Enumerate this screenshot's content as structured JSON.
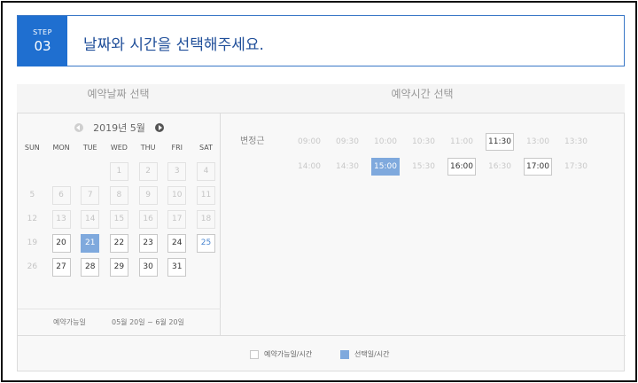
{
  "step": {
    "label": "STEP",
    "number": "03",
    "title": "날짜와 시간을 선택해주세요."
  },
  "calendar": {
    "header": "예약날짜 선택",
    "month_label": "2019년 5월",
    "weekdays": [
      "SUN",
      "MON",
      "TUE",
      "WED",
      "THU",
      "FRI",
      "SAT"
    ],
    "weeks": [
      [
        {
          "d": "",
          "s": "empty"
        },
        {
          "d": "",
          "s": "empty"
        },
        {
          "d": "",
          "s": "empty"
        },
        {
          "d": "1",
          "s": "disabled"
        },
        {
          "d": "2",
          "s": "disabled"
        },
        {
          "d": "3",
          "s": "disabled"
        },
        {
          "d": "4",
          "s": "disabled"
        }
      ],
      [
        {
          "d": "5",
          "s": "plain"
        },
        {
          "d": "6",
          "s": "disabled"
        },
        {
          "d": "7",
          "s": "disabled"
        },
        {
          "d": "8",
          "s": "disabled"
        },
        {
          "d": "9",
          "s": "disabled"
        },
        {
          "d": "10",
          "s": "disabled"
        },
        {
          "d": "11",
          "s": "disabled"
        }
      ],
      [
        {
          "d": "12",
          "s": "plain"
        },
        {
          "d": "13",
          "s": "disabled"
        },
        {
          "d": "14",
          "s": "disabled"
        },
        {
          "d": "15",
          "s": "disabled"
        },
        {
          "d": "16",
          "s": "disabled"
        },
        {
          "d": "17",
          "s": "disabled"
        },
        {
          "d": "18",
          "s": "disabled"
        }
      ],
      [
        {
          "d": "19",
          "s": "plain"
        },
        {
          "d": "20",
          "s": "avail"
        },
        {
          "d": "21",
          "s": "selected"
        },
        {
          "d": "22",
          "s": "avail"
        },
        {
          "d": "23",
          "s": "avail"
        },
        {
          "d": "24",
          "s": "avail"
        },
        {
          "d": "25",
          "s": "avail-blue"
        }
      ],
      [
        {
          "d": "26",
          "s": "plain"
        },
        {
          "d": "27",
          "s": "avail"
        },
        {
          "d": "28",
          "s": "avail"
        },
        {
          "d": "29",
          "s": "avail"
        },
        {
          "d": "30",
          "s": "avail"
        },
        {
          "d": "31",
          "s": "avail"
        },
        {
          "d": "",
          "s": "empty"
        }
      ]
    ],
    "range_label": "예약가능일",
    "range_value": "05월 20일 ~ 6월 20일"
  },
  "times": {
    "header": "예약시간 선택",
    "staff": "변정근",
    "rows": [
      [
        {
          "t": "09:00",
          "s": "disabled"
        },
        {
          "t": "09:30",
          "s": "disabled"
        },
        {
          "t": "10:00",
          "s": "disabled"
        },
        {
          "t": "10:30",
          "s": "disabled"
        },
        {
          "t": "11:00",
          "s": "disabled"
        },
        {
          "t": "11:30",
          "s": "avail"
        },
        {
          "t": "13:00",
          "s": "disabled"
        },
        {
          "t": "13:30",
          "s": "disabled"
        }
      ],
      [
        {
          "t": "14:00",
          "s": "disabled"
        },
        {
          "t": "14:30",
          "s": "disabled"
        },
        {
          "t": "15:00",
          "s": "selected"
        },
        {
          "t": "15:30",
          "s": "disabled"
        },
        {
          "t": "16:00",
          "s": "avail"
        },
        {
          "t": "16:30",
          "s": "disabled"
        },
        {
          "t": "17:00",
          "s": "avail"
        },
        {
          "t": "17:30",
          "s": "disabled"
        }
      ]
    ]
  },
  "legend": {
    "available": "예약가능일/시간",
    "selected": "선택일/시간"
  },
  "colors": {
    "accent": "#1f6fd0",
    "selected": "#7fa9dd",
    "title": "#1f4e99"
  }
}
